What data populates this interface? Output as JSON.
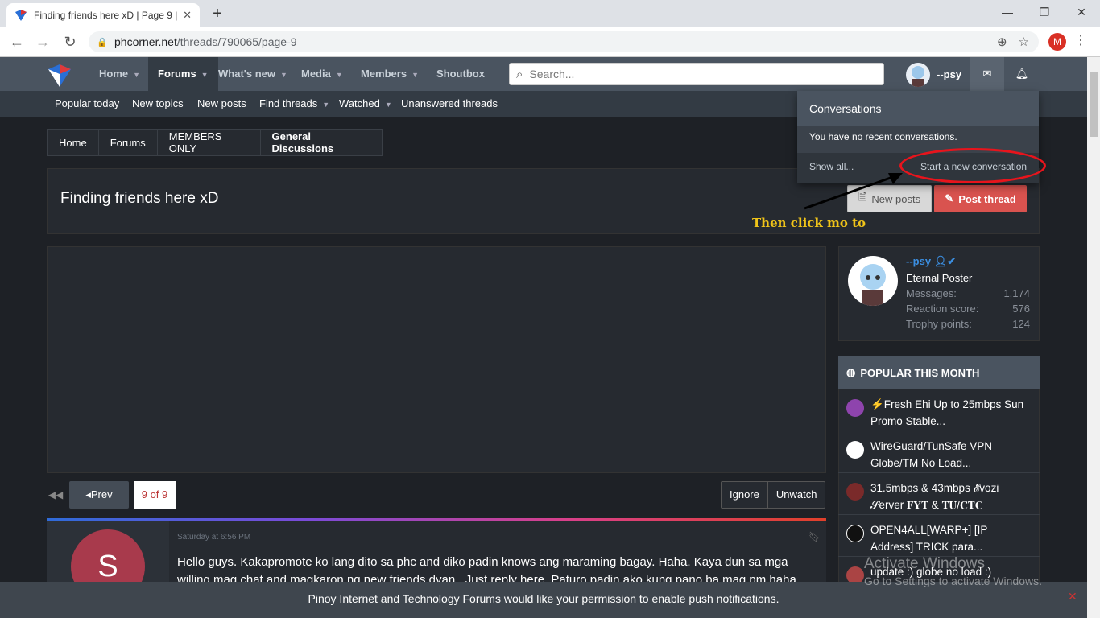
{
  "browser": {
    "tab_title": "Finding friends here xD | Page 9 |",
    "url_domain": "phcorner.net",
    "url_path": "/threads/790065/page-9",
    "profile_initial": "M"
  },
  "nav": {
    "items": [
      "Home",
      "Forums",
      "What's new",
      "Media",
      "Members",
      "Shoutbox"
    ],
    "search_placeholder": "Search...",
    "username": "--psy"
  },
  "subnav": {
    "items": [
      "Popular today",
      "New topics",
      "New posts",
      "Find threads",
      "Watched",
      "Unanswered threads"
    ]
  },
  "breadcrumb": [
    "Home",
    "Forums",
    "MEMBERS ONLY",
    "General Discussions"
  ],
  "thread": {
    "title": "Finding friends here xD",
    "new_posts_label": "New posts",
    "post_thread_label": "Post thread"
  },
  "annotation": {
    "text": "Then click mo to"
  },
  "pager": {
    "prev_label": "Prev",
    "current": "9 of 9",
    "ignore_label": "Ignore",
    "unwatch_label": "Unwatch"
  },
  "post": {
    "avatar_letter": "S",
    "date": "Saturday at 6:56 PM",
    "body": "Hello guys. Kakapromote ko lang dito sa phc and diko padin knows ang maraming bagay. Haha. Kaya dun sa mga willing mag chat and magkaron ng new friends dyan.. Just reply here. Paturo padin ako kung pano ba mag pm haha."
  },
  "userbox": {
    "name": "--psy",
    "title": "Eternal Poster",
    "stats": [
      {
        "label": "Messages:",
        "value": "1,174"
      },
      {
        "label": "Reaction score:",
        "value": "576"
      },
      {
        "label": "Trophy points:",
        "value": "124"
      }
    ]
  },
  "popular": {
    "heading": "POPULAR THIS MONTH",
    "items": [
      {
        "text": "⚡Fresh Ehi Up to 25mbps Sun Promo Stable...",
        "color": "#8e44ad"
      },
      {
        "text": "WireGuard/TunSafe VPN Globe/TM No Load...",
        "color": "#ffffff"
      },
      {
        "text": "31.5mbps & 43mbps 𝓔vozi 𝓢erver 𝐅𝐘𝐓 & 𝐓𝐔/𝐂𝐓𝐂",
        "color": "#7a2a2a"
      },
      {
        "text": "OPEN4ALL[WARP+] [IP Address] TRICK para...",
        "color": "#111111"
      },
      {
        "text": "update :) globe no load :)",
        "color": "#aa4444"
      }
    ]
  },
  "conversations": {
    "heading": "Conversations",
    "empty_text": "You have no recent conversations.",
    "show_all": "Show all...",
    "start_new": "Start a new conversation"
  },
  "push": {
    "text": "Pinoy Internet and Technology Forums would like your permission to enable push notifications."
  },
  "watermark": {
    "line1": "Activate Windows",
    "line2": "Go to Settings to activate Windows."
  }
}
